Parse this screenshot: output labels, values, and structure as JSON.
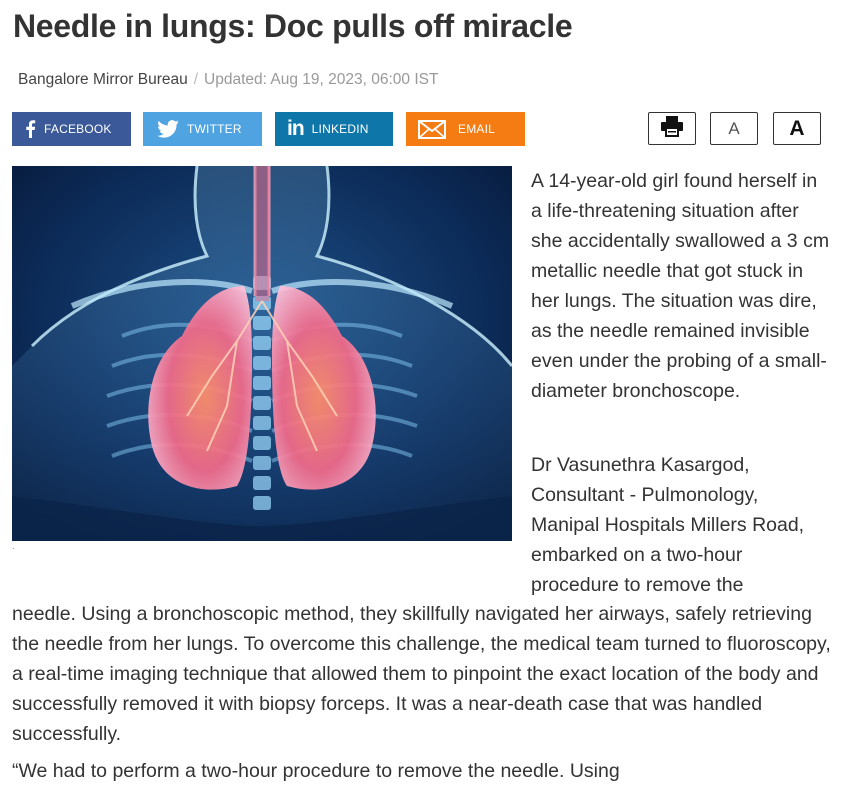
{
  "article": {
    "title": "Needle in lungs: Doc pulls off miracle",
    "byline": "Bangalore Mirror Bureau",
    "separator": "/",
    "updated": "Updated: Aug 19, 2023, 06:00 IST",
    "image_caption": ".",
    "paragraph1": "A 14-year-old girl found herself in a life-threatening situation after she accidentally swallowed a 3 cm metallic needle that got stuck in her lungs. The situation was dire, as the needle remained invisible even under the probing of a small-diameter bronchoscope.",
    "paragraph2_part1": "Dr Vasunethra Kasargod, Consultant - Pulmonology, Manipal Hospitals Millers Road, embarked on a two-hour procedure to remove the",
    "paragraph2_part2": "needle. Using a bronchoscopic method, they skillfully navigated her airways, safely retrieving the needle from her lungs. To overcome this challenge, the medical team turned to fluoroscopy, a real-time imaging technique that allowed them to pinpoint the exact location of the body and successfully removed it with biopsy forceps. It was a near-death case that was handled successfully.",
    "paragraph3_partial": "“We had to perform a two-hour procedure to remove the needle. Using"
  },
  "share": {
    "facebook": "FACEBOOK",
    "twitter": "TWITTER",
    "linkedin": "LINKEDIN",
    "email": "EMAIL"
  },
  "tools": {
    "font_small": "A",
    "font_large": "A"
  },
  "colors": {
    "facebook": "#3b5998",
    "twitter": "#4fa3e0",
    "linkedin": "#0e76a8",
    "email": "#f57c12"
  },
  "icons": {
    "print": "printer-icon",
    "facebook": "facebook-icon",
    "twitter": "twitter-bird-icon",
    "linkedin": "linkedin-icon",
    "email": "envelope-icon"
  }
}
